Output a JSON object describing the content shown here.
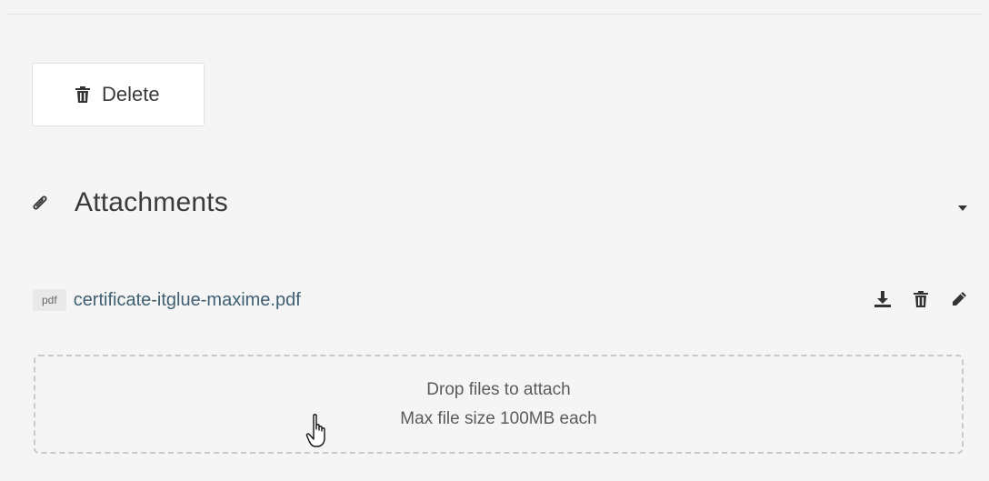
{
  "toolbar": {
    "delete_label": "Delete"
  },
  "attachments": {
    "title": "Attachments",
    "files": [
      {
        "type_badge": "pdf",
        "name": "certificate-itglue-maxime.pdf"
      }
    ],
    "drop_zone": {
      "line1": "Drop files to attach",
      "line2": "Max file size 100MB each"
    }
  },
  "icons": {
    "delete": "trash-icon",
    "section": "paperclip-icon",
    "collapse": "caret-down-icon",
    "download": "download-icon",
    "remove": "trash-icon",
    "edit": "pencil-icon",
    "cursor": "hand-pointer-icon"
  },
  "colors": {
    "background": "#f5f5f5",
    "file_link": "#3f5f73",
    "icon": "#333333"
  }
}
